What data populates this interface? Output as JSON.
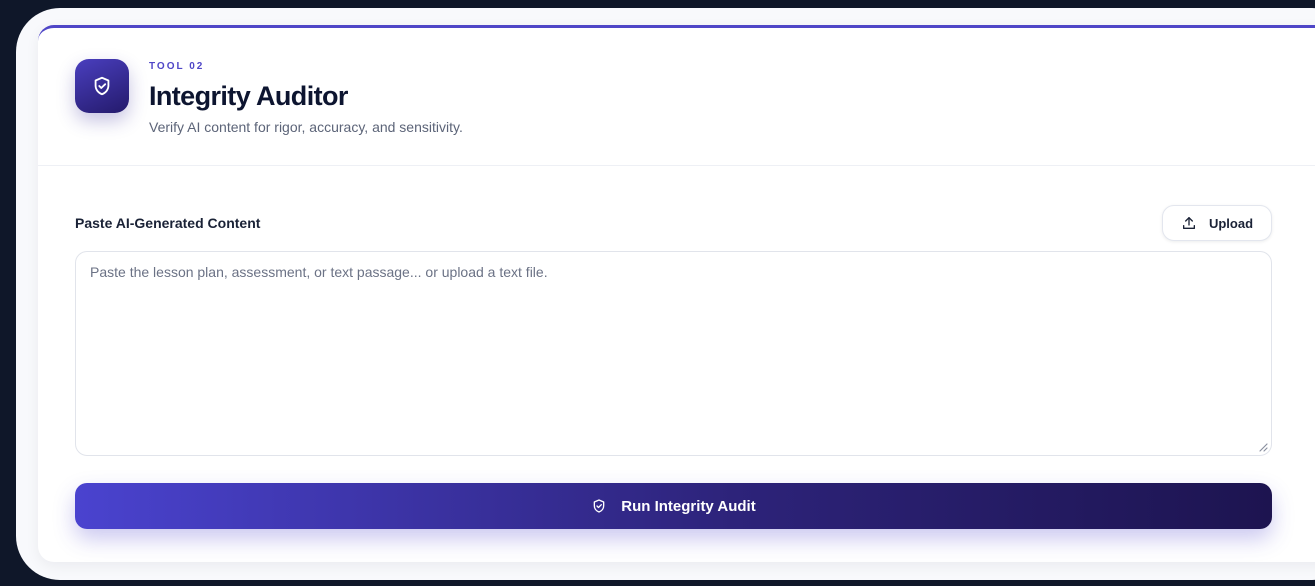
{
  "tool": {
    "kicker": "TOOL 02",
    "title": "Integrity Auditor",
    "subtitle": "Verify AI content for rigor, accuracy, and sensitivity.",
    "icon": "shield-check-icon"
  },
  "content": {
    "label": "Paste AI-Generated Content",
    "upload_label": "Upload",
    "upload_icon": "upload-icon",
    "placeholder": "Paste the lesson plan, assessment, or text passage... or upload a text file.",
    "value": ""
  },
  "action": {
    "run_label": "Run Integrity Audit",
    "run_icon": "shield-check-icon"
  },
  "colors": {
    "page_bg": "#0f1729",
    "accent": "#4f46c7",
    "button_gradient_start": "#4a43cf",
    "button_gradient_end": "#1d1450"
  }
}
